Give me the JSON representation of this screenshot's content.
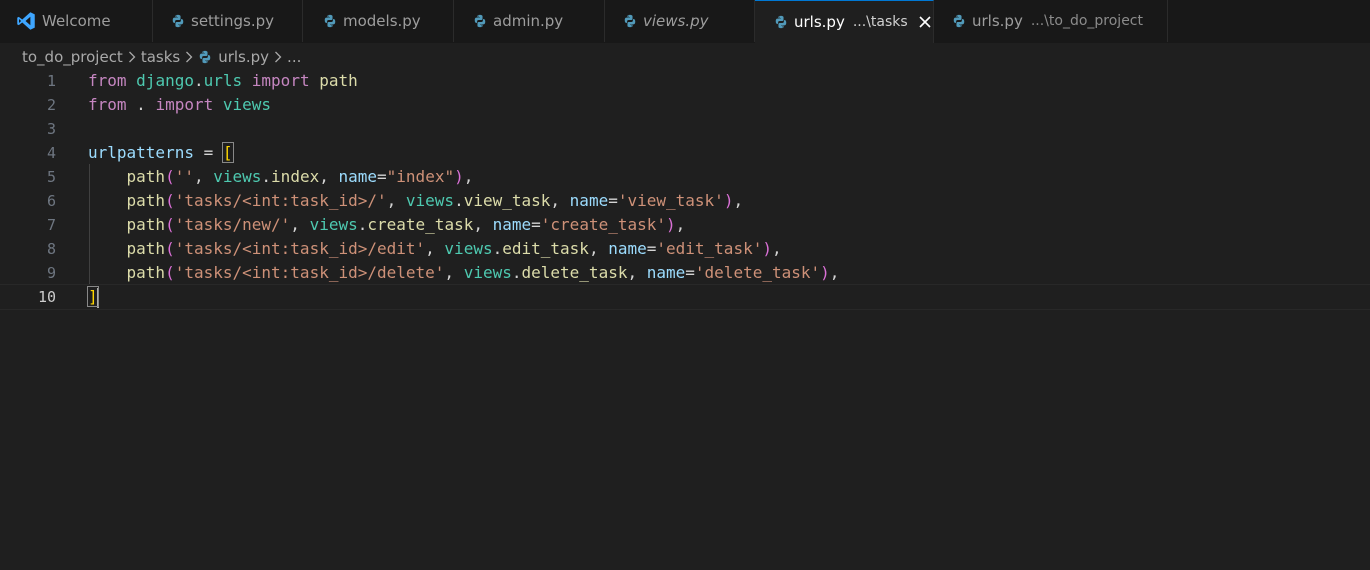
{
  "tabs": [
    {
      "label": "Welcome",
      "description": "",
      "icon": "vscode-icon",
      "italic": false,
      "active": false
    },
    {
      "label": "settings.py",
      "description": "",
      "icon": "python-icon",
      "italic": false,
      "active": false
    },
    {
      "label": "models.py",
      "description": "",
      "icon": "python-icon",
      "italic": false,
      "active": false
    },
    {
      "label": "admin.py",
      "description": "",
      "icon": "python-icon",
      "italic": false,
      "active": false
    },
    {
      "label": "views.py",
      "description": "",
      "icon": "python-icon",
      "italic": true,
      "active": false
    },
    {
      "label": "urls.py",
      "description": "...\\tasks",
      "icon": "python-icon",
      "italic": false,
      "active": true
    },
    {
      "label": "urls.py",
      "description": "...\\to_do_project",
      "icon": "python-icon",
      "italic": false,
      "active": false
    }
  ],
  "breadcrumb": {
    "items": [
      "to_do_project",
      "tasks"
    ],
    "file": "urls.py",
    "ellipsis": "..."
  },
  "editor": {
    "current_line": 10,
    "lines": [
      {
        "n": "1",
        "text": "from django.urls import path"
      },
      {
        "n": "2",
        "text": "from . import views"
      },
      {
        "n": "3",
        "text": ""
      },
      {
        "n": "4",
        "text": "urlpatterns = ["
      },
      {
        "n": "5",
        "text": "    path('', views.index, name=\"index\"),"
      },
      {
        "n": "6",
        "text": "    path('tasks/<int:task_id>/', views.view_task, name='view_task'),"
      },
      {
        "n": "7",
        "text": "    path('tasks/new/', views.create_task, name='create_task'),"
      },
      {
        "n": "8",
        "text": "    path('tasks/<int:task_id>/edit', views.edit_task, name='edit_task'),"
      },
      {
        "n": "9",
        "text": "    path('tasks/<int:task_id>/delete', views.delete_task, name='delete_task'),"
      },
      {
        "n": "10",
        "text": "]"
      }
    ]
  },
  "colors": {
    "keyword": "#c586c0",
    "module": "#4ec9b0",
    "variable": "#9cdcfe",
    "function": "#dcdcaa",
    "string": "#ce9178",
    "bracket_level1": "#ffd700",
    "bracket_level2": "#da70d6",
    "accent": "#0078d4",
    "python_blue": "#519aba"
  }
}
